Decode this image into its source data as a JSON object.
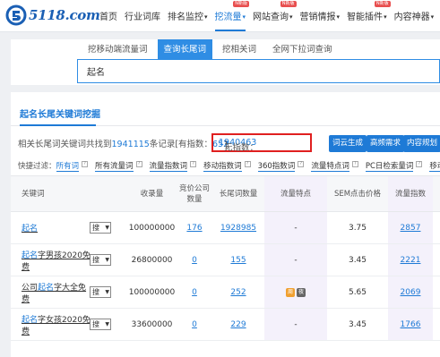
{
  "brand": {
    "logo_text": "5118.com"
  },
  "nav": [
    {
      "label": "首页"
    },
    {
      "label": "行业词库"
    },
    {
      "label": "排名监控",
      "caret": "▾"
    },
    {
      "label": "挖流量",
      "caret": "▾",
      "badge": "N新版",
      "active": true
    },
    {
      "label": "网站查询",
      "caret": "▾",
      "badge": "N新版"
    },
    {
      "label": "营销情报",
      "caret": "▾"
    },
    {
      "label": "智能插件",
      "caret": "▾",
      "badge": "N新版"
    },
    {
      "label": "内容神器",
      "caret": "▾"
    }
  ],
  "tabs": [
    "挖移动端流量词",
    "查询长尾词",
    "挖相关词",
    "全网下拉词查询"
  ],
  "search": {
    "value": "起名"
  },
  "section": {
    "title": "起名长尾关键词挖掘"
  },
  "summary": {
    "prefix": "相关长尾词关键词共找到",
    "total": "1941115",
    "mid": "条记录[有指数：",
    "with_index": "652",
    "no_index_label": "无指数：",
    "no_index": "1940463",
    "suffix": "]"
  },
  "buttons": [
    "词云生成",
    "高频需求",
    "内容规划"
  ],
  "quick_filters": {
    "label": "快捷过滤：",
    "items": [
      "所有词",
      "所有流量词",
      "流量指数词",
      "移动指数词",
      "360指数词",
      "流量特点词",
      "PC日检索量词",
      "移动日检"
    ]
  },
  "table": {
    "headers": [
      "关键词",
      "收录量",
      "竞价公司数量",
      "长尾词数量",
      "流量特点",
      "SEM点击价格",
      "流量指数"
    ],
    "select_label": "搜",
    "rows": [
      {
        "keyword_pre": "",
        "keyword_hl": "起名",
        "keyword_post": "",
        "indexed": "100000000",
        "bidding": "176",
        "longtail": "1928985",
        "feature": "-",
        "sem": "3.75",
        "index": "2857"
      },
      {
        "keyword_pre": "",
        "keyword_hl": "起名",
        "keyword_post": "字男孩2020免费",
        "indexed": "26800000",
        "bidding": "0",
        "longtail": "155",
        "feature": "-",
        "sem": "3.45",
        "index": "2221"
      },
      {
        "keyword_pre": "公司",
        "keyword_hl": "起名",
        "keyword_post": "字大全免费",
        "indexed": "100000000",
        "bidding": "0",
        "longtail": "252",
        "feature": "icons",
        "sem": "5.65",
        "index": "2069"
      },
      {
        "keyword_pre": "",
        "keyword_hl": "起名",
        "keyword_post": "字女孩2020免费",
        "indexed": "33600000",
        "bidding": "0",
        "longtail": "229",
        "feature": "-",
        "sem": "3.45",
        "index": "1766"
      }
    ],
    "feature_icons": [
      "周",
      "夜"
    ]
  }
}
